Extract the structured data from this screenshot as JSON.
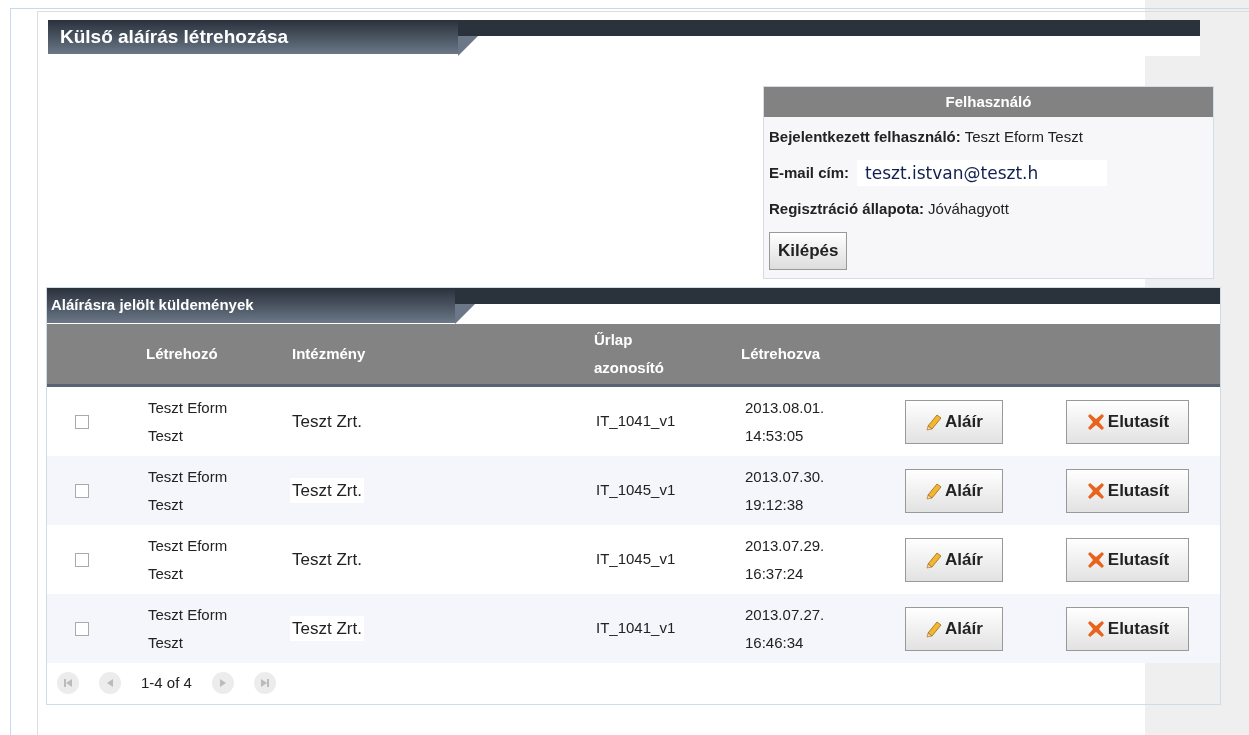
{
  "page_title": "Külső aláírás létrehozása",
  "user_panel": {
    "title": "Felhasználó",
    "fields": [
      {
        "kind": "text",
        "label": "Bejelentkezett felhasználó:",
        "value": "Teszt Eform Teszt"
      },
      {
        "kind": "input",
        "label": "E-mail cím:",
        "value": "teszt.istvan@teszt.h"
      },
      {
        "kind": "text",
        "label": "Regisztráció állapota:",
        "value": "Jóváhagyott"
      }
    ],
    "logout_button": "Kilépés"
  },
  "table": {
    "title": "Aláírásra jelölt küldemények",
    "columns": [
      "Létrehozó",
      "Intézmény",
      "Űrlap azonosító",
      "Létrehozva"
    ],
    "rows": [
      {
        "checked": false,
        "creator": "Teszt Eform Teszt",
        "institution": "Teszt Zrt.",
        "form_id": "IT_1041_v1",
        "created": "2013.08.01. 14:53:05",
        "sign": "Aláír",
        "reject": "Elutasít"
      },
      {
        "checked": false,
        "creator": "Teszt Eform Teszt",
        "institution": "Teszt Zrt.",
        "form_id": "IT_1045_v1",
        "created": "2013.07.30. 19:12:38",
        "sign": "Aláír",
        "reject": "Elutasít"
      },
      {
        "checked": false,
        "creator": "Teszt Eform Teszt",
        "institution": "Teszt Zrt.",
        "form_id": "IT_1045_v1",
        "created": "2013.07.29. 16:37:24",
        "sign": "Aláír",
        "reject": "Elutasít"
      },
      {
        "checked": false,
        "creator": "Teszt Eform Teszt",
        "institution": "Teszt Zrt.",
        "form_id": "IT_1041_v1",
        "created": "2013.07.27. 16:46:34",
        "sign": "Aláír",
        "reject": "Elutasít"
      }
    ],
    "pager": "1-4 of 4"
  }
}
